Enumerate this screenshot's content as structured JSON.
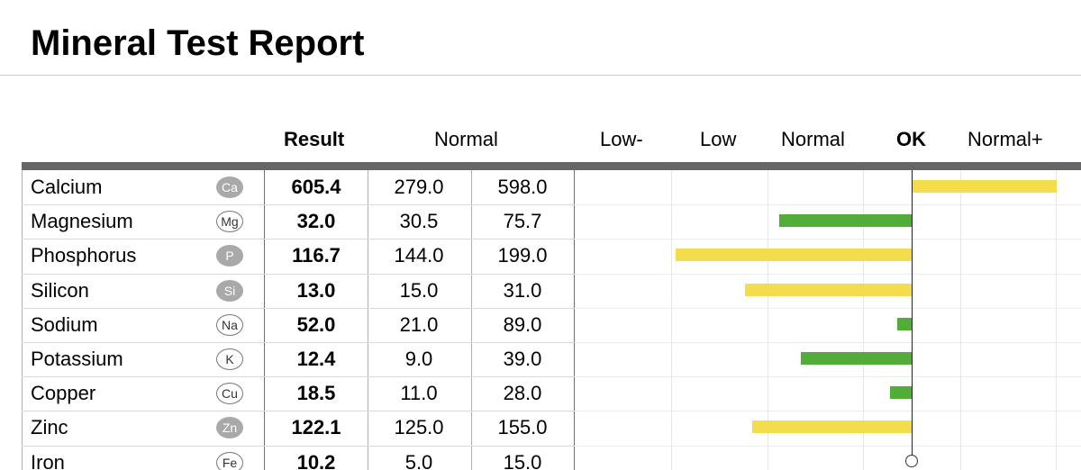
{
  "title": "Mineral Test Report",
  "headers": {
    "result": "Result",
    "normal": "Normal",
    "scale": [
      "Low-",
      "Low",
      "Normal",
      "OK",
      "Normal+"
    ]
  },
  "colors": {
    "in_range": "#52ad38",
    "out_of_range": "#f3dd4c",
    "header_bar": "#666666",
    "symbol_filled": "#a9a9a9"
  },
  "rows": [
    {
      "name": "Calcium",
      "symbol": "Ca",
      "symbol_style": "filled",
      "result": "605.4",
      "normal_low": "279.0",
      "normal_high": "598.0"
    },
    {
      "name": "Magnesium",
      "symbol": "Mg",
      "symbol_style": "outline",
      "result": "32.0",
      "normal_low": "30.5",
      "normal_high": "75.7"
    },
    {
      "name": "Phosphorus",
      "symbol": "P",
      "symbol_style": "filled",
      "result": "116.7",
      "normal_low": "144.0",
      "normal_high": "199.0"
    },
    {
      "name": "Silicon",
      "symbol": "Si",
      "symbol_style": "filled",
      "result": "13.0",
      "normal_low": "15.0",
      "normal_high": "31.0"
    },
    {
      "name": "Sodium",
      "symbol": "Na",
      "symbol_style": "outline",
      "result": "52.0",
      "normal_low": "21.0",
      "normal_high": "89.0"
    },
    {
      "name": "Potassium",
      "symbol": "K",
      "symbol_style": "outline",
      "result": "12.4",
      "normal_low": "9.0",
      "normal_high": "39.0"
    },
    {
      "name": "Copper",
      "symbol": "Cu",
      "symbol_style": "outline",
      "result": "18.5",
      "normal_low": "11.0",
      "normal_high": "28.0"
    },
    {
      "name": "Zinc",
      "symbol": "Zn",
      "symbol_style": "filled",
      "result": "122.1",
      "normal_low": "125.0",
      "normal_high": "155.0"
    },
    {
      "name": "Iron",
      "symbol": "Fe",
      "symbol_style": "outline",
      "result": "10.2",
      "normal_low": "5.0",
      "normal_high": "15.0"
    }
  ],
  "chart_data": {
    "type": "bar",
    "orientation": "horizontal",
    "baseline_category": "OK",
    "scale_categories": [
      "Low-",
      "Low",
      "Normal",
      "OK",
      "Normal+"
    ],
    "note": "bar value = deviation from OK line in scale steps (negative = left/low side, positive = right/high side)",
    "series": [
      {
        "category": "Calcium",
        "value": 1.5,
        "status": "out_of_range"
      },
      {
        "category": "Magnesium",
        "value": -1.37,
        "status": "in_range"
      },
      {
        "category": "Phosphorus",
        "value": -2.45,
        "status": "out_of_range"
      },
      {
        "category": "Silicon",
        "value": -1.73,
        "status": "out_of_range"
      },
      {
        "category": "Sodium",
        "value": -0.15,
        "status": "in_range"
      },
      {
        "category": "Potassium",
        "value": -1.15,
        "status": "in_range"
      },
      {
        "category": "Copper",
        "value": -0.22,
        "status": "in_range"
      },
      {
        "category": "Zinc",
        "value": -1.65,
        "status": "out_of_range"
      },
      {
        "category": "Iron",
        "value": 0,
        "status": "in_range"
      }
    ],
    "xlim": [
      -3.5,
      1.75
    ]
  }
}
